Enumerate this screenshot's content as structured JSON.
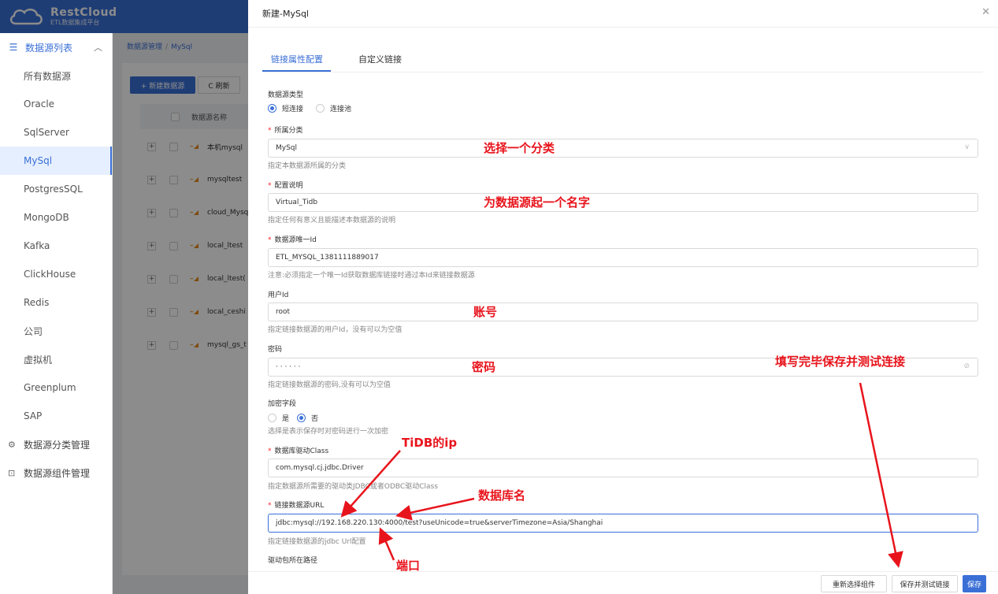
{
  "logo": {
    "name": "RestCloud",
    "sub": "ETL数据集成平台"
  },
  "sidebar": {
    "group": "数据源列表",
    "items": [
      {
        "label": "所有数据源"
      },
      {
        "label": "Oracle"
      },
      {
        "label": "SqlServer"
      },
      {
        "label": "MySql"
      },
      {
        "label": "PostgresSQL"
      },
      {
        "label": "MongoDB"
      },
      {
        "label": "Kafka"
      },
      {
        "label": "ClickHouse"
      },
      {
        "label": "Redis"
      },
      {
        "label": "公司"
      },
      {
        "label": "虚拟机"
      },
      {
        "label": "Greenplum"
      },
      {
        "label": "SAP"
      }
    ],
    "category_mgmt": "数据源分类管理",
    "component_mgmt": "数据源组件管理"
  },
  "main": {
    "breadcrumb": [
      "数据源管理",
      "MySql"
    ],
    "new_button": "+ 新建数据源",
    "refresh_button": "C 刷新",
    "table_header": "数据源名称",
    "rows": [
      "本机mysql",
      "mysqltest",
      "cloud_Mysq",
      "local_ltest",
      "local_ltest(",
      "local_ceshi",
      "mysql_gs_t"
    ]
  },
  "drawer": {
    "title": "新建-MySql",
    "tabs": [
      "链接属性配置",
      "自定义链接"
    ],
    "type_label": "数据源类型",
    "type_options": [
      "短连接",
      "连接池"
    ],
    "category_label": "所属分类",
    "category_value": "MySql",
    "category_hint": "指定本数据源所属的分类",
    "desc_label": "配置说明",
    "desc_value": "Virtual_Tidb",
    "desc_hint": "指定任何有意义且能描述本数据源的说明",
    "id_label": "数据源唯一Id",
    "id_value": "ETL_MYSQL_1381111889017",
    "id_hint": "注意:必须指定一个唯一Id获取数据库链接时通过本Id来链接数据源",
    "user_label": "用户Id",
    "user_value": "root",
    "user_hint": "指定链接数据源的用户Id，没有可以为空值",
    "pwd_label": "密码",
    "pwd_value": "· · · · · ·",
    "pwd_hint": "指定链接数据源的密码,没有可以为空值",
    "encrypt_label": "加密字段",
    "encrypt_options": [
      "是",
      "否"
    ],
    "encrypt_hint": "选择是表示保存时对密码进行一次加密",
    "driver_label": "数据库驱动Class",
    "driver_value": "com.mysql.cj.jdbc.Driver",
    "driver_hint": "指定数据源所需要的驱动类JDBC或者ODBC驱动Class",
    "url_label": "链接数据源URL",
    "url_value": "jdbc:mysql://192.168.220.130:4000/test?useUnicode=true&serverTimezone=Asia/Shanghai",
    "url_hint": "指定链接数据源的jdbc Url配置",
    "driver_path_label": "驱动包所在路径",
    "footer": {
      "reselect": "重新选择组件",
      "save_test": "保存并测试链接",
      "save": "保存"
    }
  },
  "annotations": {
    "category": "选择一个分类",
    "name": "为数据源起一个名字",
    "account": "账号",
    "password": "密码",
    "save_test": "填写完毕保存并测试连接",
    "ip": "TiDB的ip",
    "dbname": "数据库名",
    "port": "端口"
  },
  "colors": {
    "accent": "#3a6fd6",
    "annotation": "#e8141c",
    "required": "#f5222d"
  }
}
